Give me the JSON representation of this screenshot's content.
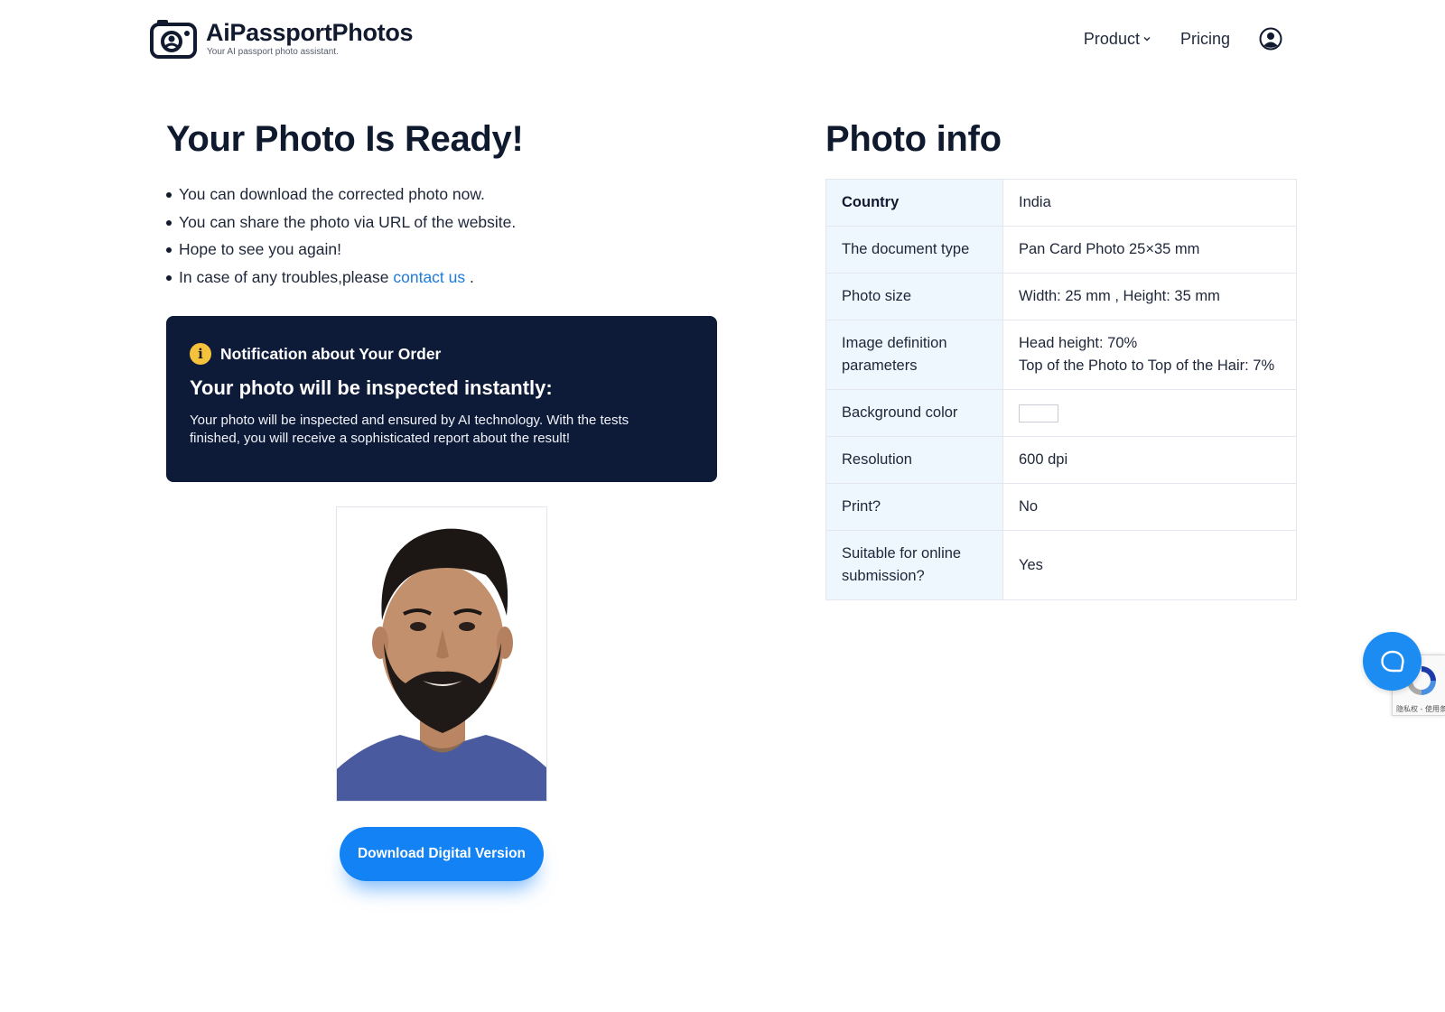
{
  "header": {
    "logo_title": "AiPassportPhotos",
    "logo_tagline": "Your AI passport photo assistant.",
    "nav": [
      {
        "label": "Product"
      },
      {
        "label": "Pricing"
      }
    ]
  },
  "main": {
    "title": "Your Photo Is Ready!",
    "bullets": [
      "You can download the corrected photo now.",
      "You can share the photo via URL of the website.",
      "Hope to see you again!"
    ],
    "bullet_contact_prefix": "In case of any troubles,please ",
    "contact_link": "contact us",
    "bullet_contact_suffix": " ."
  },
  "notice": {
    "heading": "Notification about Your Order",
    "title": "Your photo will be inspected instantly:",
    "body": "Your photo will be inspected and ensured by AI technology. With the tests finished, you will receive a sophisticated report about the result!"
  },
  "download_button": "Download Digital Version",
  "info": {
    "title": "Photo info",
    "rows": [
      {
        "key": "Country",
        "value": "India"
      },
      {
        "key": "The document type",
        "value": "Pan Card Photo 25×35 mm"
      },
      {
        "key": "Photo size",
        "value": "Width: 25 mm , Height: 35 mm"
      },
      {
        "key": "Image definition parameters",
        "value_lines": [
          "Head height: 70%",
          "Top of the Photo to Top of the Hair: 7%"
        ]
      },
      {
        "key": "Background color",
        "swatch": "#ffffff"
      },
      {
        "key": "Resolution",
        "value": "600 dpi"
      },
      {
        "key": "Print?",
        "value": "No"
      },
      {
        "key": "Suitable for online submission?",
        "value": "Yes"
      }
    ]
  },
  "recaptcha_text": "隐私权 - 使用条款",
  "colors": {
    "accent": "#1282f5",
    "notice_bg": "#0d1a38",
    "table_key_bg": "#eef6fe",
    "link": "#1f7ad8"
  }
}
